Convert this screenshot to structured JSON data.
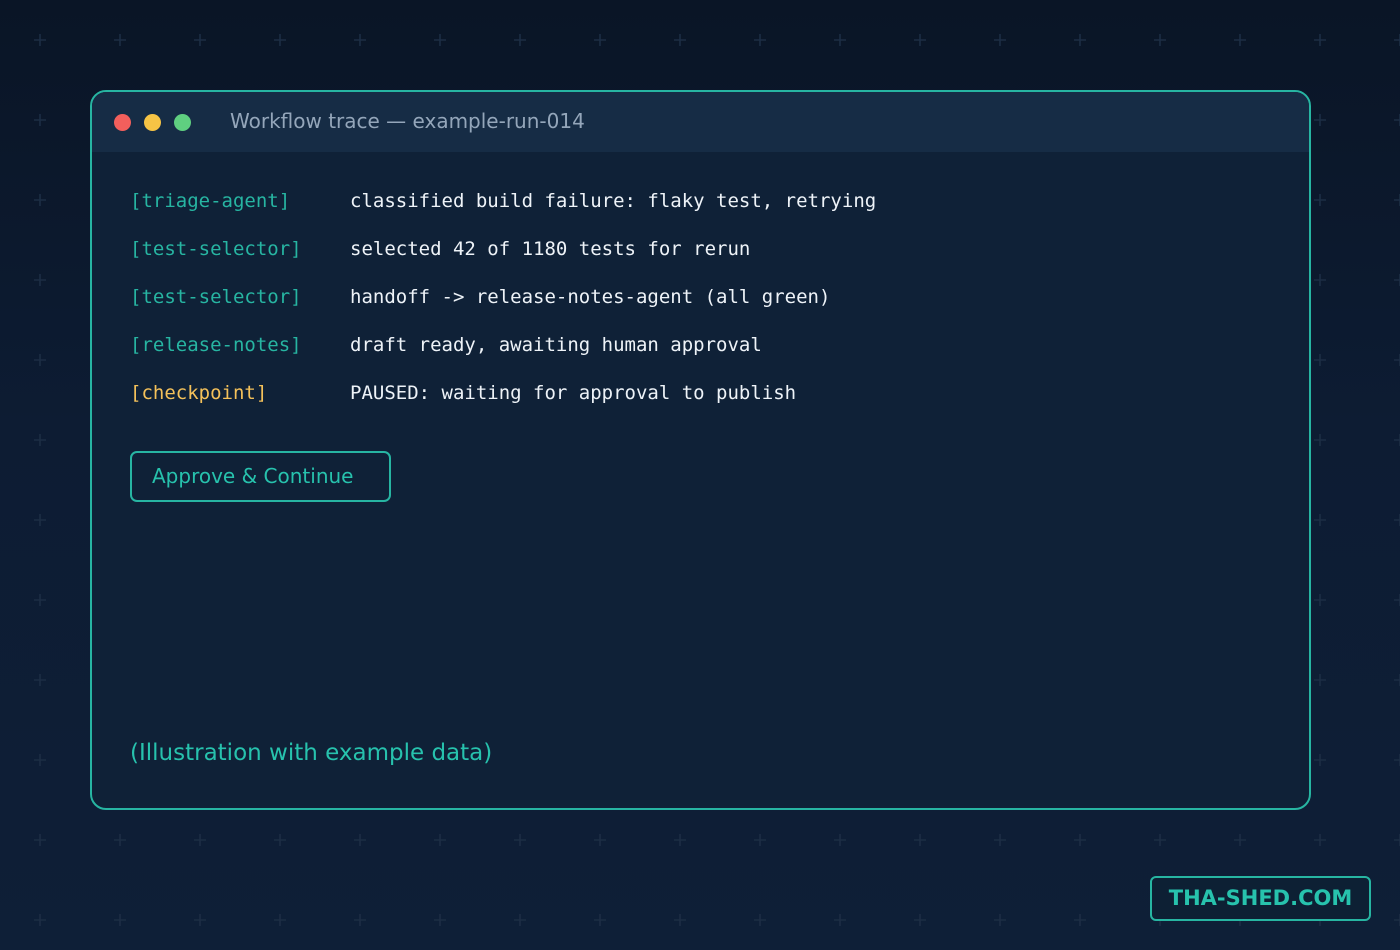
{
  "window": {
    "title": "Workflow trace — example-run-014"
  },
  "log": [
    {
      "agent": "[triage-agent]",
      "message": "classified build failure: flaky test, retrying",
      "status": "normal"
    },
    {
      "agent": "[test-selector]",
      "message": "selected 42 of 1180 tests for rerun",
      "status": "normal"
    },
    {
      "agent": "[test-selector]",
      "message": "handoff -> release-notes-agent (all green)",
      "status": "normal"
    },
    {
      "agent": "[release-notes]",
      "message": "draft ready, awaiting human approval",
      "status": "normal"
    },
    {
      "agent": "[checkpoint]",
      "message": "PAUSED: waiting for approval to publish",
      "status": "paused"
    }
  ],
  "actions": {
    "approve_label": "Approve & Continue"
  },
  "caption": "(Illustration with example data)",
  "brand": "THA-SHED.COM",
  "colors": {
    "accent": "#27b5a2",
    "warning": "#f4c15a",
    "close_dot": "#f25f5c",
    "minimize_dot": "#f6c445",
    "maximize_dot": "#5fcf80",
    "background": "#0d1c33",
    "window": "#0f2137"
  }
}
